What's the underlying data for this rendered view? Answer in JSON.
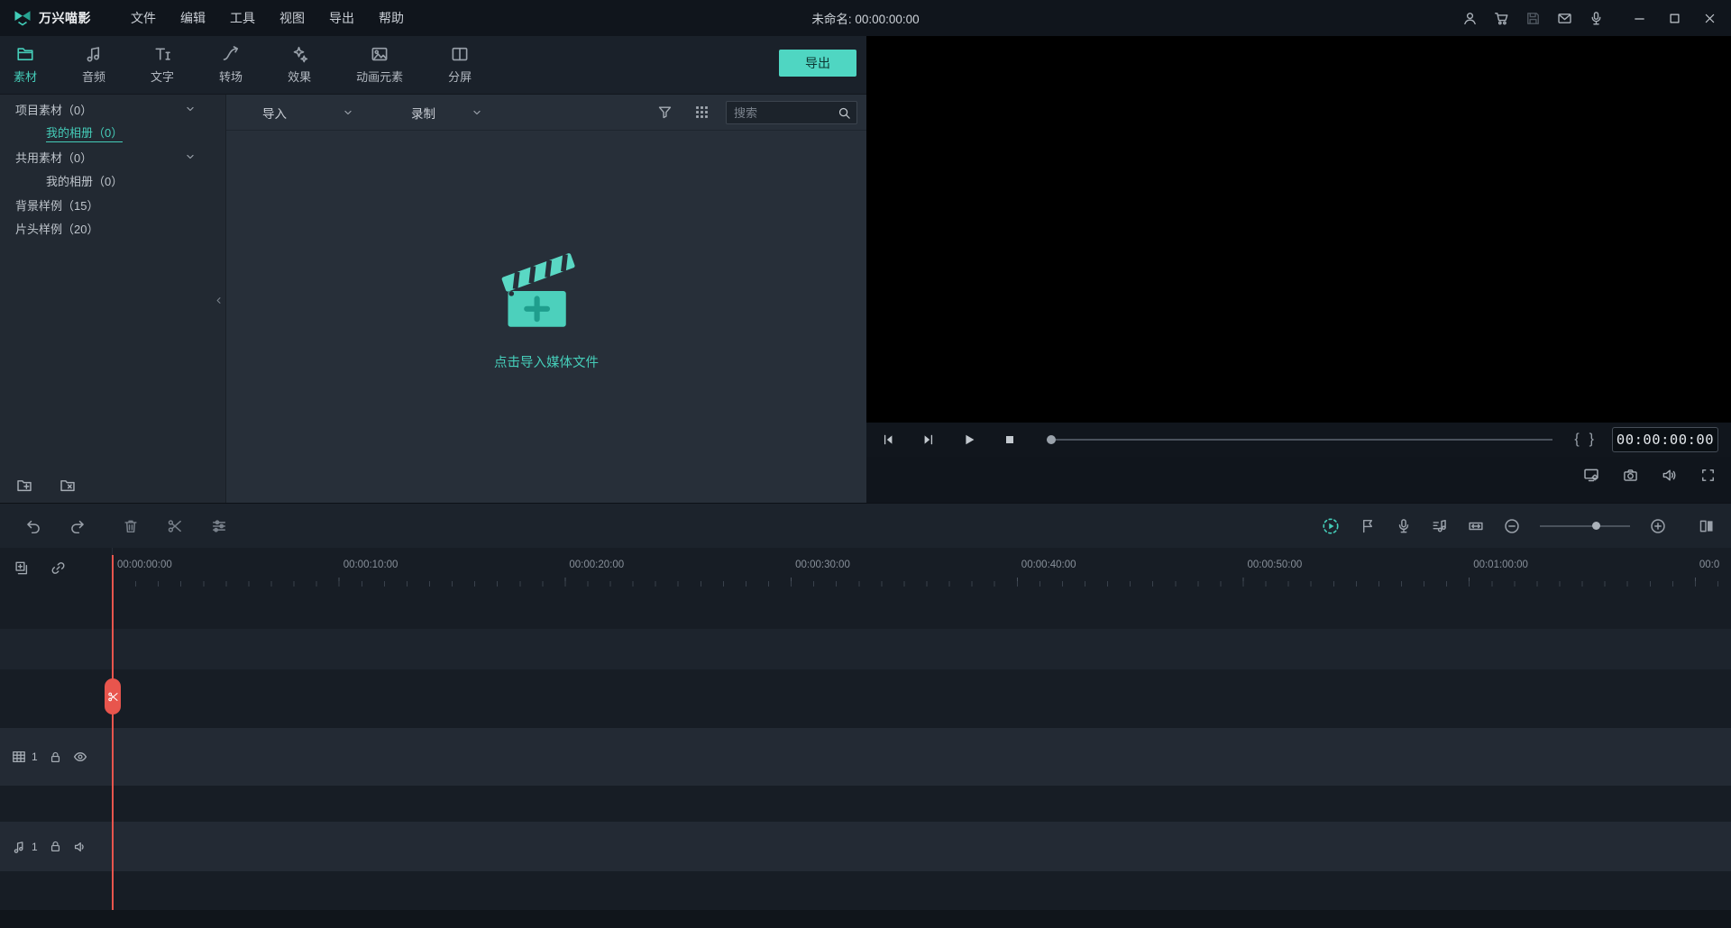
{
  "titlebar": {
    "app_name": "万兴喵影",
    "menus": [
      "文件",
      "编辑",
      "工具",
      "视图",
      "导出",
      "帮助"
    ],
    "project_title": "未命名: 00:00:00:00"
  },
  "tabs": {
    "items": [
      {
        "id": "media",
        "label": "素材",
        "active": true
      },
      {
        "id": "audio",
        "label": "音频",
        "active": false
      },
      {
        "id": "text",
        "label": "文字",
        "active": false
      },
      {
        "id": "transition",
        "label": "转场",
        "active": false
      },
      {
        "id": "effects",
        "label": "效果",
        "active": false
      },
      {
        "id": "elements",
        "label": "动画元素",
        "active": false
      },
      {
        "id": "split",
        "label": "分屏",
        "active": false
      }
    ],
    "export_label": "导出"
  },
  "sidebar": {
    "items": [
      {
        "label": "项目素材（0）",
        "level": 0,
        "chevron": true,
        "selected": false
      },
      {
        "label": "我的相册（0）",
        "level": 1,
        "chevron": false,
        "selected": true
      },
      {
        "label": "共用素材（0）",
        "level": 0,
        "chevron": true,
        "selected": false
      },
      {
        "label": "我的相册（0）",
        "level": 1,
        "chevron": false,
        "selected": false
      },
      {
        "label": "背景样例（15）",
        "level": 0,
        "chevron": false,
        "selected": false
      },
      {
        "label": "片头样例（20）",
        "level": 0,
        "chevron": false,
        "selected": false
      }
    ]
  },
  "media_panel": {
    "import_label": "导入",
    "record_label": "录制",
    "search_placeholder": "搜索",
    "empty_text": "点击导入媒体文件"
  },
  "preview": {
    "timecode": "00:00:00:00"
  },
  "timeline": {
    "ruler_labels": [
      "00:00:00:00",
      "00:00:10:00",
      "00:00:20:00",
      "00:00:30:00",
      "00:00:40:00",
      "00:00:50:00",
      "00:01:00:00",
      "00:0"
    ],
    "video_track_number": "1",
    "audio_track_number": "1"
  },
  "colors": {
    "accent": "#45cdb9",
    "export_button": "#4fd6c2",
    "playhead": "#e8554d"
  }
}
